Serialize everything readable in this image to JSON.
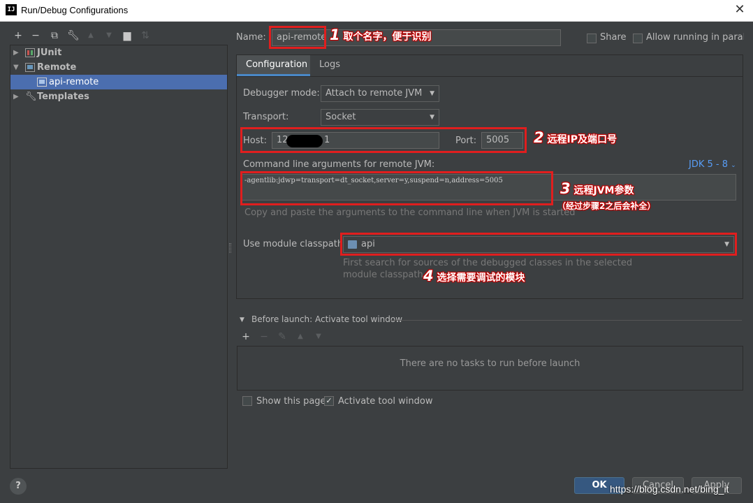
{
  "window": {
    "title": "Run/Debug Configurations",
    "app_icon_text": "IJ",
    "close_glyph": "✕"
  },
  "toolbar": {
    "icons": [
      "add-icon",
      "remove-icon",
      "copy-icon",
      "wrench-icon",
      "move-up-icon",
      "move-down-icon",
      "folder-icon",
      "sort-icon"
    ]
  },
  "tree": {
    "items": [
      {
        "label": "JUnit",
        "icon": "junit-icon",
        "expanded": false
      },
      {
        "label": "Remote",
        "icon": "remote-icon",
        "expanded": true
      },
      {
        "label": "api-remote",
        "icon": "remote-config-icon",
        "selected": true
      },
      {
        "label": "Templates",
        "icon": "wrench-icon",
        "expanded": false
      }
    ]
  },
  "form": {
    "name_label": "Name:",
    "name_value": "api-remote",
    "share_label": "Share",
    "allow_parallel_label": "Allow running in parallel",
    "tabs": [
      "Configuration",
      "Logs"
    ],
    "active_tab": "Configuration",
    "debugger_mode_label": "Debugger mode:",
    "debugger_mode_value": "Attach to remote JVM",
    "transport_label": "Transport:",
    "transport_value": "Socket",
    "host_label": "Host:",
    "host_value_prefix": "12",
    "host_value_suffix": "1",
    "port_label": "Port:",
    "port_value": "5005",
    "cmd_label": "Command line arguments for remote JVM:",
    "jdk_link": "JDK 5 - 8",
    "cmd_value": "-agentlib:jdwp=transport=dt_socket,server=y,suspend=n,address=5005",
    "cmd_hint": "Copy and paste the arguments to the command line when JVM is started",
    "module_label": "Use module classpath:",
    "module_value": "api",
    "module_hint_line1": "First search for sources of the debugged classes in the selected",
    "module_hint_line2": "module classpath",
    "before_launch_label": "Before launch: Activate tool window",
    "no_tasks_text": "There are no tasks to run before launch",
    "show_page_label": "Show this page",
    "activate_tool_label": "Activate tool window",
    "activate_tool_checked": true
  },
  "annotations": {
    "a1_num": "1",
    "a1_text": "取个名字，便于识别",
    "a2_num": "2",
    "a2_text": "远程IP及端口号",
    "a3_num": "3",
    "a3_text": "远程JVM参数",
    "a3_sub": "（经过步骤2之后会补全）",
    "a4_num": "4",
    "a4_text": "选择需要调试的模块"
  },
  "footer": {
    "help": "?",
    "ok": "OK",
    "cancel": "Cancel",
    "apply": "Apply",
    "watermark": "https://blog.csdn.net/bing_it"
  },
  "colors": {
    "background": "#3c3f41",
    "selection": "#4b6eaf",
    "annotation_red": "#e01e1e",
    "link": "#589df6"
  }
}
